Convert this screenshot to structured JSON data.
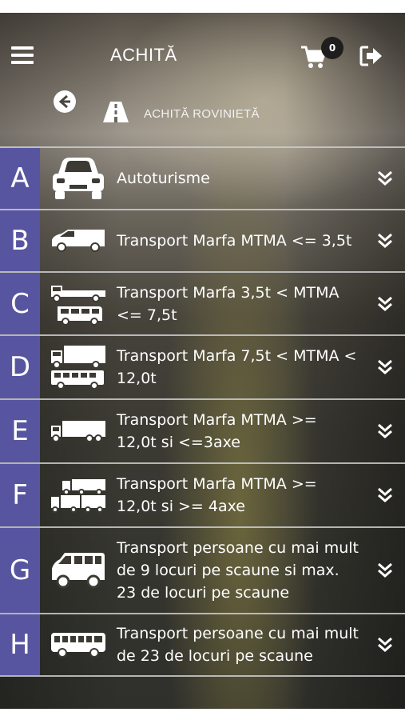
{
  "header": {
    "title": "ACHITĂ",
    "cart_count": "0",
    "breadcrumb": "ACHITĂ ROVINIETĂ"
  },
  "theme": {
    "letter_bg": "#5855a0",
    "badge_bg": "#1e1e1e"
  },
  "categories": [
    {
      "letter": "A",
      "label": "Autoturisme",
      "icon": "car-icon"
    },
    {
      "letter": "B",
      "label": "Transport Marfa MTMA <= 3,5t",
      "icon": "van-icon"
    },
    {
      "letter": "C",
      "label": "Transport Marfa 3,5t < MTMA <= 7,5t",
      "icon": "truck-minibus-icon"
    },
    {
      "letter": "D",
      "label": "Transport Marfa 7,5t < MTMA < 12,0t",
      "icon": "truck-bus-icon"
    },
    {
      "letter": "E",
      "label": "Transport Marfa MTMA >= 12,0t si <=3axe",
      "icon": "lorry-icon"
    },
    {
      "letter": "F",
      "label": "Transport Marfa MTMA >= 12,0t si >= 4axe",
      "icon": "trailer-truck-icon"
    },
    {
      "letter": "G",
      "label": "Transport persoane cu mai mult de 9 locuri pe scaune si max. 23 de locuri pe scaune",
      "icon": "minibus-icon"
    },
    {
      "letter": "H",
      "label": "Transport persoane cu mai mult de 23 de locuri pe scaune",
      "icon": "bus-icon"
    }
  ]
}
